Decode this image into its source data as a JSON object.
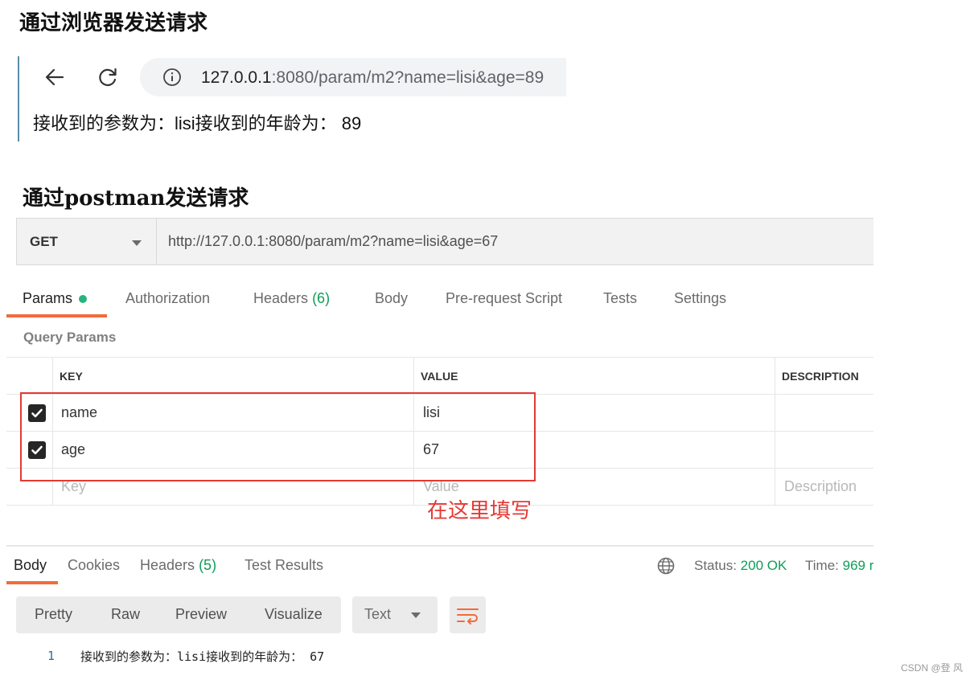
{
  "headings": {
    "browser": "通过浏览器发送请求",
    "postman": "通过postman发送请求"
  },
  "browser": {
    "url_host": "127.0.0.1",
    "url_rest": ":8080/param/m2?name=lisi&age=89",
    "page_text": "接收到的参数为：lisi接收到的年龄为： 89"
  },
  "request": {
    "method": "GET",
    "url": "http://127.0.0.1:8080/param/m2?name=lisi&age=67"
  },
  "tabs": {
    "params": "Params",
    "authorization": "Authorization",
    "headers": "Headers",
    "headers_count": "(6)",
    "body": "Body",
    "prerequest": "Pre-request Script",
    "tests": "Tests",
    "settings": "Settings"
  },
  "query_params": {
    "label": "Query Params",
    "columns": {
      "key": "KEY",
      "value": "VALUE",
      "description": "DESCRIPTION"
    },
    "rows": [
      {
        "checked": true,
        "key": "name",
        "value": "lisi"
      },
      {
        "checked": true,
        "key": "age",
        "value": "67"
      }
    ],
    "placeholders": {
      "key": "Key",
      "value": "Value",
      "description": "Description"
    }
  },
  "annotation": "在这里填写",
  "response": {
    "tabs": {
      "body": "Body",
      "cookies": "Cookies",
      "headers": "Headers",
      "headers_count": "(5)",
      "test_results": "Test Results"
    },
    "status_label": "Status:",
    "status_value": "200 OK",
    "time_label": "Time:",
    "time_value": "969 r",
    "views": [
      "Pretty",
      "Raw",
      "Preview",
      "Visualize"
    ],
    "format": "Text",
    "lines": [
      {
        "num": "1",
        "text": "接收到的参数为：lisi接收到的年龄为： 67"
      }
    ]
  },
  "watermark": "CSDN @登 风"
}
